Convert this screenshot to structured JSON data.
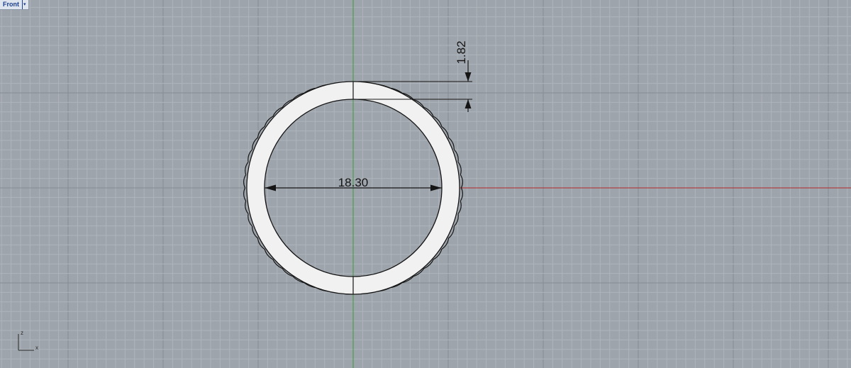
{
  "viewport": {
    "name": "Front",
    "menu_arrow": "▾"
  },
  "dimensions": {
    "inner_diameter": "18.30",
    "band_thickness": "1.82"
  },
  "axis_icon": {
    "vertical_label": "z",
    "horizontal_label": "x"
  },
  "colors": {
    "background": "#9ea4ab",
    "grid_minor": "#aeb4bb",
    "grid_major": "#868c93",
    "axis_x": "#b3282a",
    "axis_z": "#3c9a3c",
    "band_fill": "#f1f1f1",
    "outline": "#151515"
  },
  "icons": {
    "menu": "chevron-down-icon",
    "axes": "world-axes-icon"
  }
}
